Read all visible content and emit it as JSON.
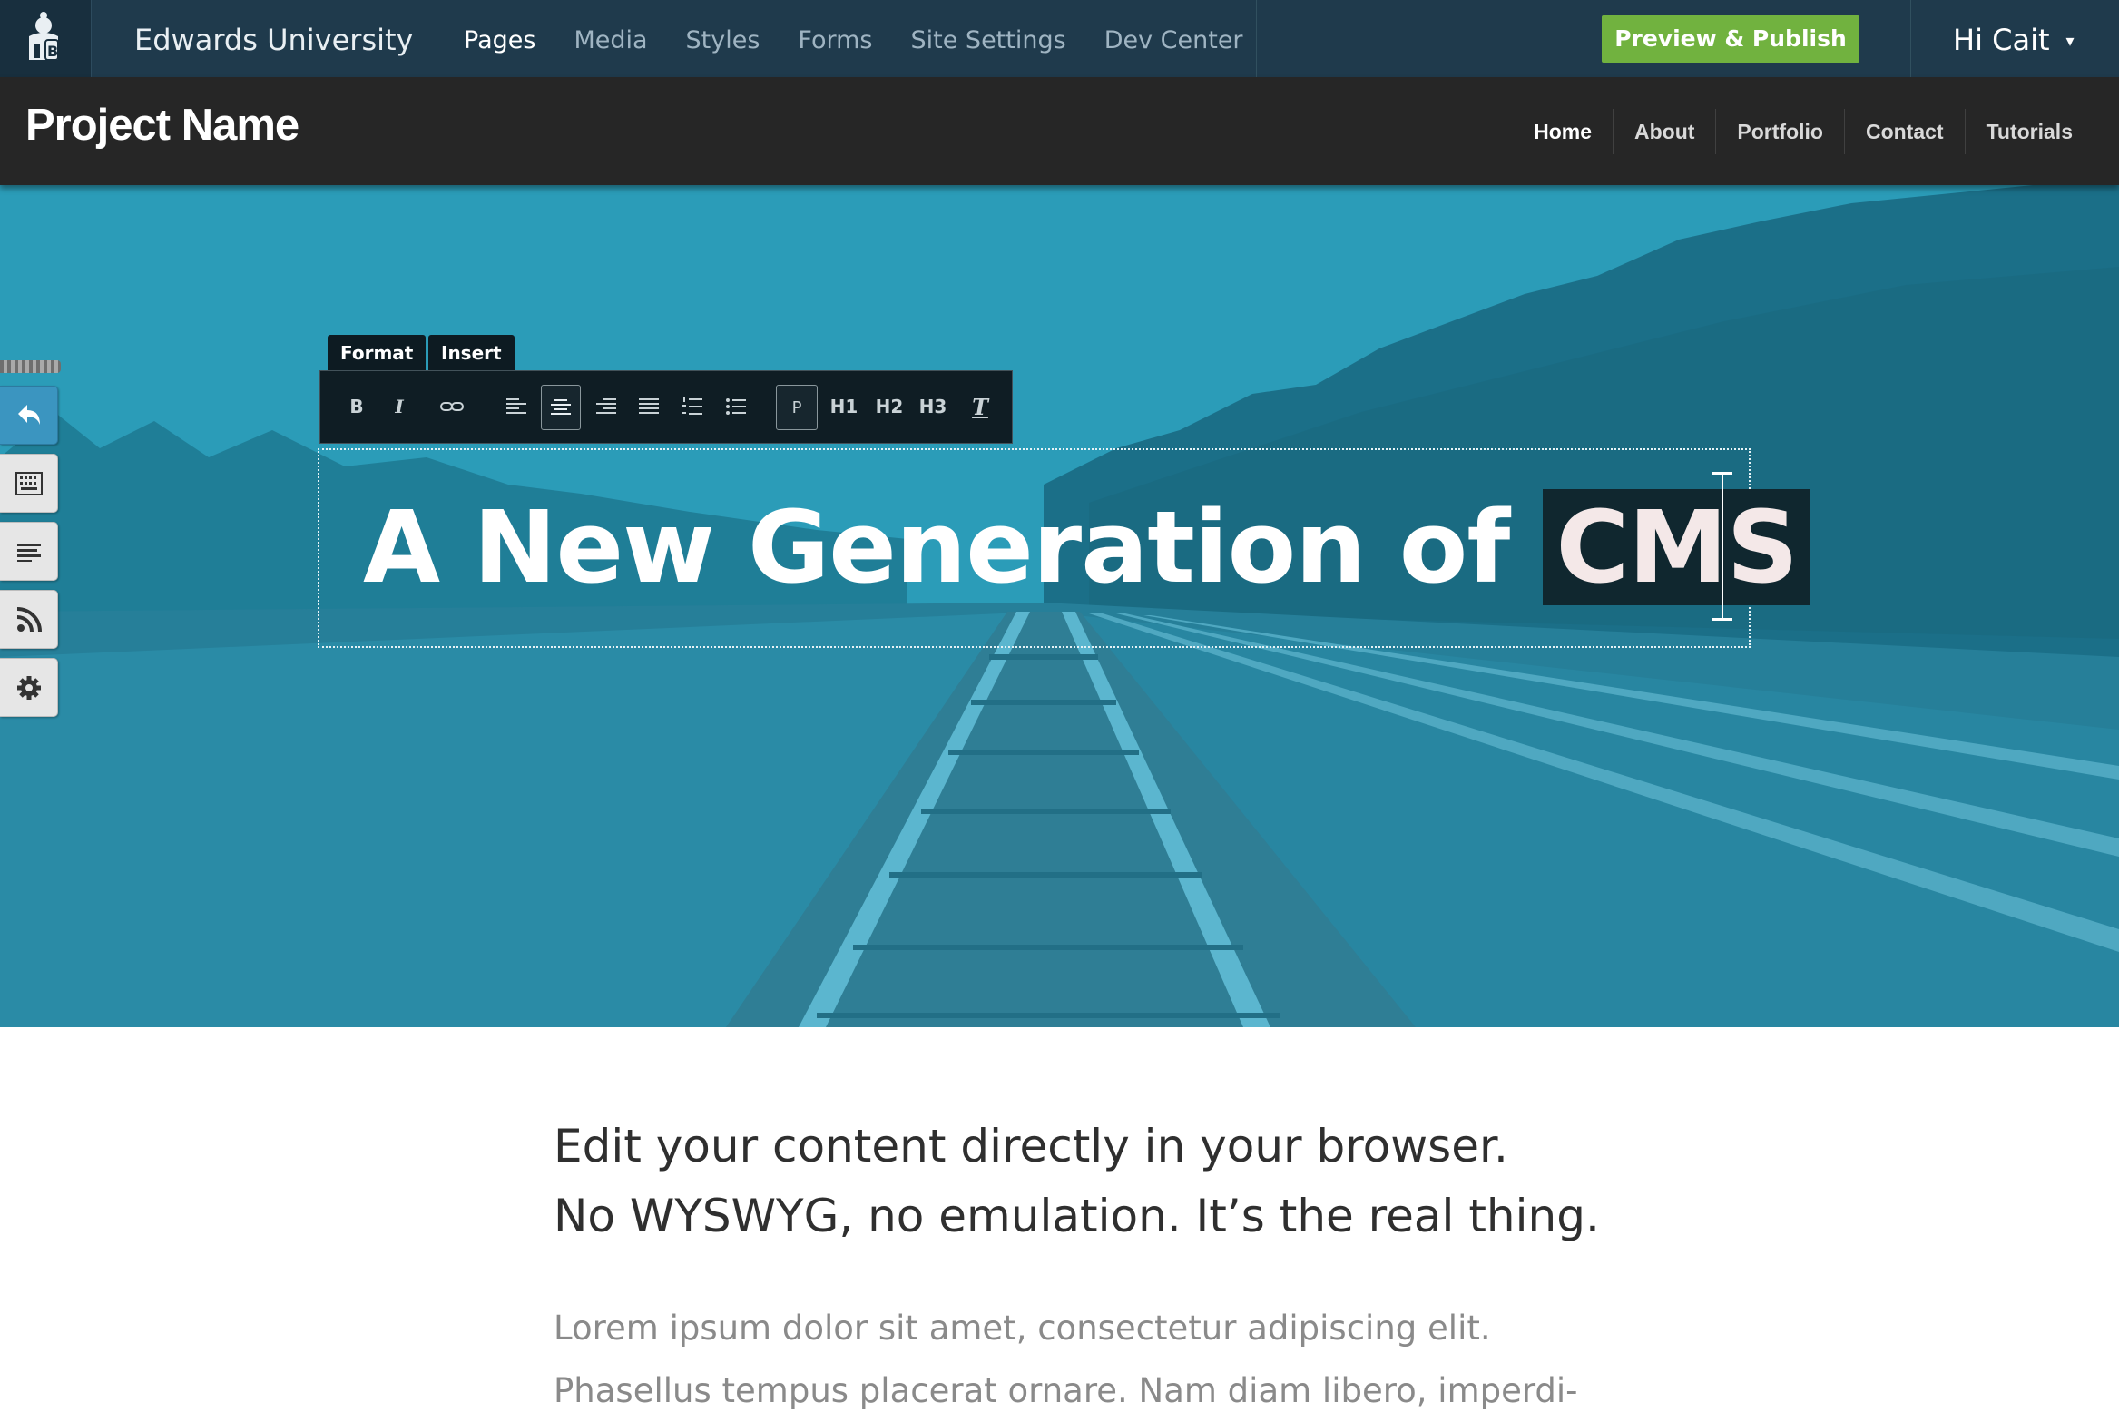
{
  "cms": {
    "org_name": "Edwards University",
    "nav": [
      {
        "label": "Pages",
        "active": true
      },
      {
        "label": "Media",
        "active": false
      },
      {
        "label": "Styles",
        "active": false
      },
      {
        "label": "Forms",
        "active": false
      },
      {
        "label": "Site Settings",
        "active": false
      },
      {
        "label": "Dev Center",
        "active": false
      }
    ],
    "publish_label": "Preview & Publish",
    "user_greeting": "Hi Cait",
    "user_caret": "▾"
  },
  "site": {
    "brand": "Project Name",
    "nav": [
      {
        "label": "Home",
        "active": true
      },
      {
        "label": "About",
        "active": false
      },
      {
        "label": "Portfolio",
        "active": false
      },
      {
        "label": "Contact",
        "active": false
      },
      {
        "label": "Tutorials",
        "active": false
      }
    ]
  },
  "editor": {
    "tabs": [
      "Format",
      "Insert"
    ],
    "toolbar": {
      "bold": "B",
      "italic": "I",
      "paragraph": "P",
      "h1": "H1",
      "h2": "H2",
      "h3": "H3",
      "clear_format": "T"
    },
    "heading_text": "A New Generation of ",
    "heading_selected": "CMS"
  },
  "content": {
    "lead_line1": "Edit your content directly in your browser.",
    "lead_line2": "No WYSWYG, no emulation. It’s the real thing.",
    "body_line1": "Lorem ipsum dolor sit amet, consectetur adipiscing elit.",
    "body_line2": "Phasellus tempus placerat ornare. Nam diam libero, imperdi-"
  },
  "colors": {
    "cms_bar": "#1f3a4c",
    "publish": "#71b23f",
    "site_header": "#262626",
    "hero_tint": "#2a97b3"
  },
  "icons": [
    "logo-icon",
    "undo-icon",
    "keyboard-icon",
    "text-block-icon",
    "rss-icon",
    "gear-icon",
    "link-icon",
    "align-left-icon",
    "align-center-icon",
    "align-right-icon",
    "align-justify-icon",
    "ordered-list-icon",
    "bullet-list-icon",
    "clear-format-icon"
  ]
}
